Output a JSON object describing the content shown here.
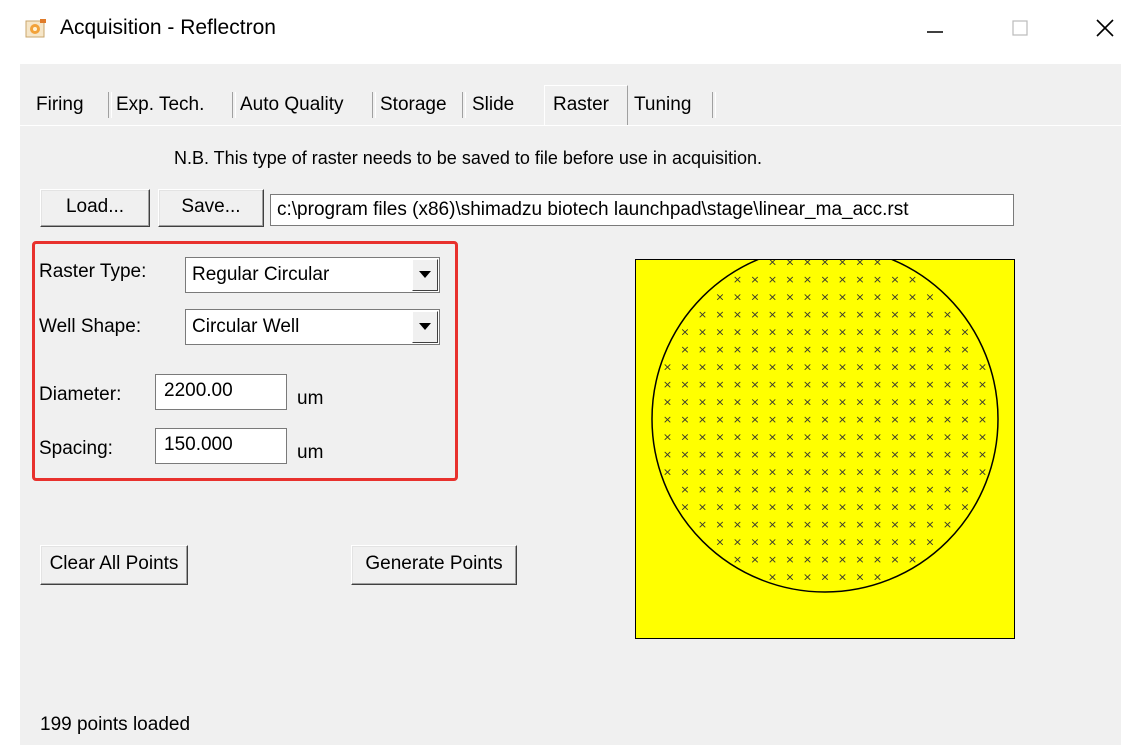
{
  "window": {
    "title": "Acquisition - Reflectron",
    "icon": "app-gear-icon",
    "controls": [
      "minimize-icon",
      "maximize-icon",
      "close-icon"
    ]
  },
  "tabs": [
    {
      "label": "Firing",
      "active": false
    },
    {
      "label": "Exp. Tech.",
      "active": false
    },
    {
      "label": "Auto Quality",
      "active": false
    },
    {
      "label": "Storage",
      "active": false
    },
    {
      "label": "Slide",
      "active": false
    },
    {
      "label": "Raster",
      "active": true
    },
    {
      "label": "Tuning",
      "active": false
    }
  ],
  "raster": {
    "note": "N.B. This type of raster needs to be saved to file before use in acquisition.",
    "load_label": "Load...",
    "save_label": "Save...",
    "file_path": "c:\\program files (x86)\\shimadzu biotech launchpad\\stage\\linear_ma_acc.rst",
    "raster_type_label": "Raster Type:",
    "raster_type_value": "Regular Circular",
    "well_shape_label": "Well Shape:",
    "well_shape_value": "Circular Well",
    "diameter_label": "Diameter:",
    "diameter_value": "2200.00",
    "diameter_unit": "um",
    "spacing_label": "Spacing:",
    "spacing_value": "150.000",
    "spacing_unit": "um",
    "clear_label": "Clear All Points",
    "generate_label": "Generate Points",
    "status": "199 points loaded",
    "preview_fill_color": "#ffff00",
    "highlight_color": "#e8312d"
  }
}
